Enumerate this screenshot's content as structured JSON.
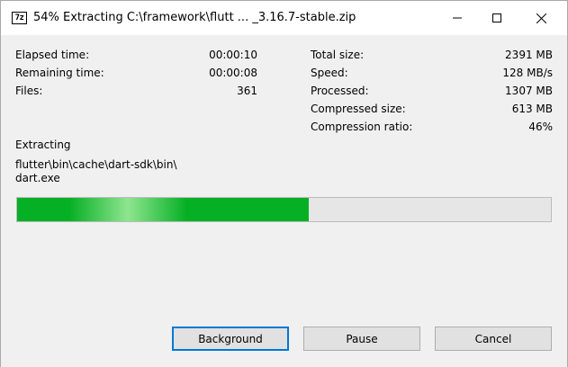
{
  "window": {
    "title": "54% Extracting C:\\framework\\flutt ... _3.16.7-stable.zip",
    "app_icon_text": "7z"
  },
  "stats_left": [
    {
      "label": "Elapsed time:",
      "value": "00:00:10"
    },
    {
      "label": "Remaining time:",
      "value": "00:00:08"
    },
    {
      "label": "Files:",
      "value": "361"
    }
  ],
  "stats_right": [
    {
      "label": "Total size:",
      "value": "2391 MB"
    },
    {
      "label": "Speed:",
      "value": "128 MB/s"
    },
    {
      "label": "Processed:",
      "value": "1307 MB"
    },
    {
      "label": "Compressed size:",
      "value": "613 MB"
    },
    {
      "label": "Compression ratio:",
      "value": "46%"
    }
  ],
  "status": {
    "action": "Extracting",
    "path_line1": "flutter\\bin\\cache\\dart-sdk\\bin\\",
    "path_line2": "dart.exe"
  },
  "progress": {
    "fraction": 0.546,
    "color": "#06b025"
  },
  "buttons": {
    "background": "Background",
    "pause": "Pause",
    "cancel": "Cancel"
  }
}
